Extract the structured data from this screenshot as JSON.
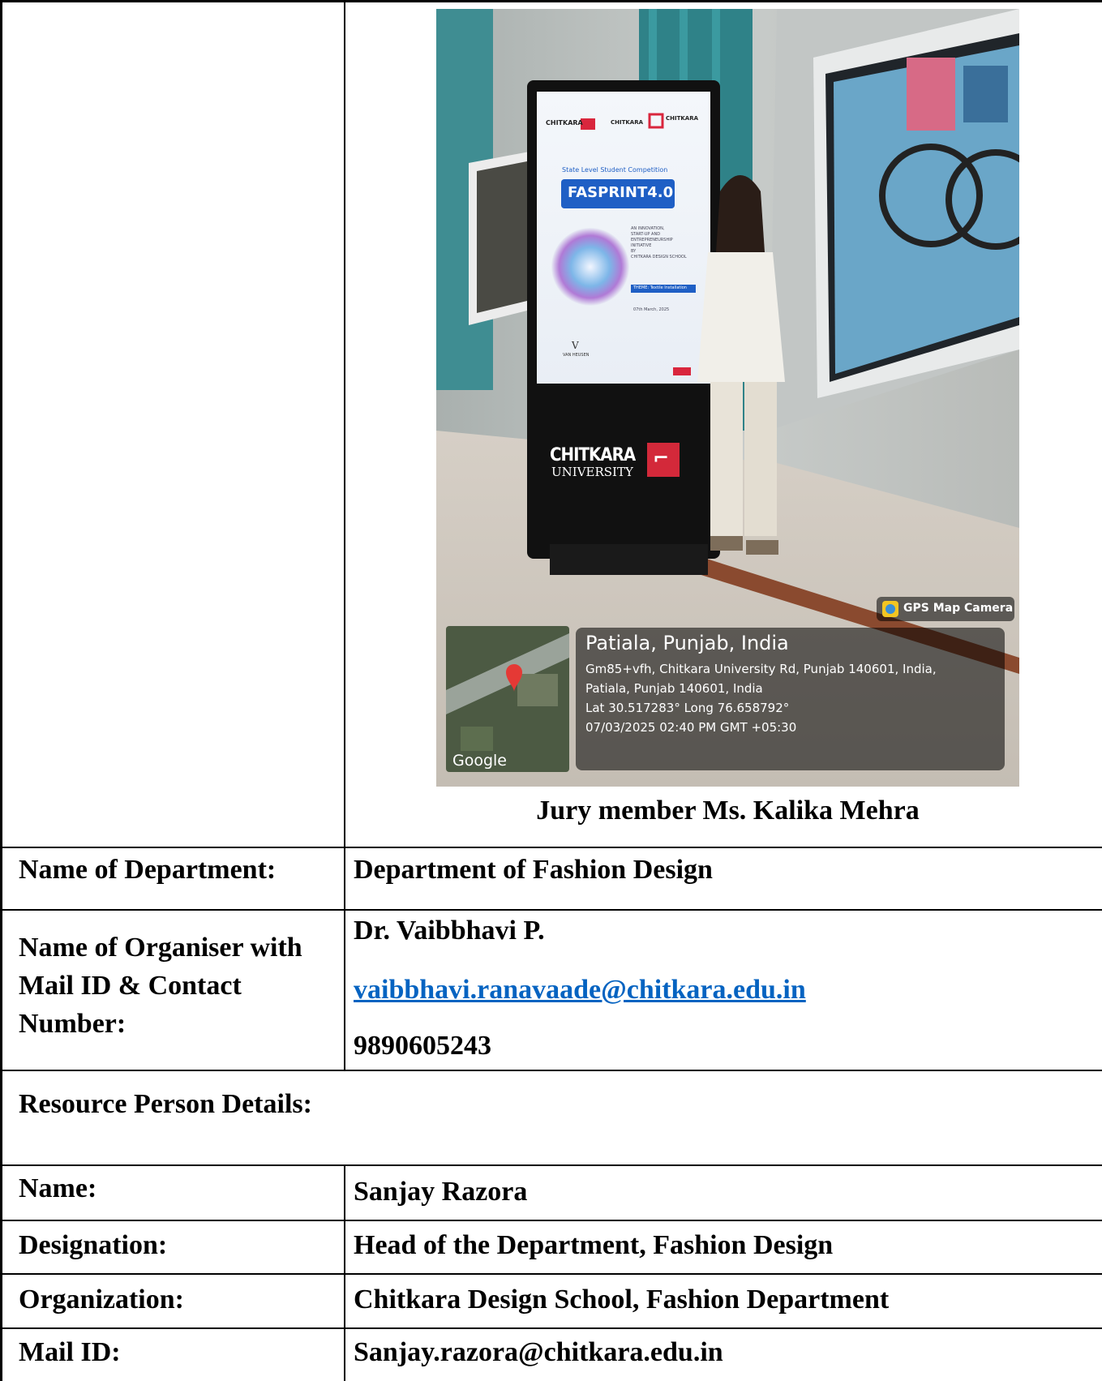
{
  "photo": {
    "screen": {
      "logo_left": "CHITKARA",
      "logo_mid": "CHITKARA",
      "logo_right": "CHITKARA",
      "kicker": "State Level Student Competition",
      "event": "FASPRINT4.0",
      "tagline": [
        "AN INNOVATION,",
        "START-UP AND",
        "ENTREPRENEURSHIP",
        "INITIATIVE",
        "BY",
        "CHITKARA DESIGN SCHOOL"
      ],
      "theme": "THEME: Textile Installation",
      "date": "07th March, 2025",
      "sponsor_mark": "V",
      "sponsor_name": "VAN HEUSEN"
    },
    "kiosk_brand": "CHITKARA",
    "kiosk_sub": "UNIVERSITY",
    "map_brand": "Google",
    "gps_badge": "GPS Map Camera",
    "location_title": "Patiala, Punjab, India",
    "address_line1": "Gm85+vfh, Chitkara University Rd, Punjab 140601, India,",
    "address_line2": "Patiala, Punjab 140601, India",
    "coords": "Lat 30.517283° Long 76.658792°",
    "timestamp": "07/03/2025 02:40 PM GMT +05:30"
  },
  "caption": "Jury member Ms. Kalika Mehra",
  "rows": {
    "department_label": "Name of Department:",
    "department_value": "Department of Fashion Design",
    "organiser_label": [
      "Name of Organiser with",
      "Mail ID & Contact",
      "Number:"
    ],
    "organiser_name": "Dr. Vaibbhavi P.",
    "organiser_email": "vaibbhavi.ranavaade@chitkara.edu.in",
    "organiser_phone": "9890605243",
    "resource_heading": "Resource Person Details:",
    "name_label": "Name:",
    "name_value": "Sanjay Razora",
    "designation_label": "Designation:",
    "designation_value": "Head of the Department, Fashion Design",
    "organization_label": "Organization:",
    "organization_value": "Chitkara Design School, Fashion Department",
    "mail_label": "Mail ID:",
    "mail_value": "Sanjay.razora@chitkara.edu.in"
  }
}
